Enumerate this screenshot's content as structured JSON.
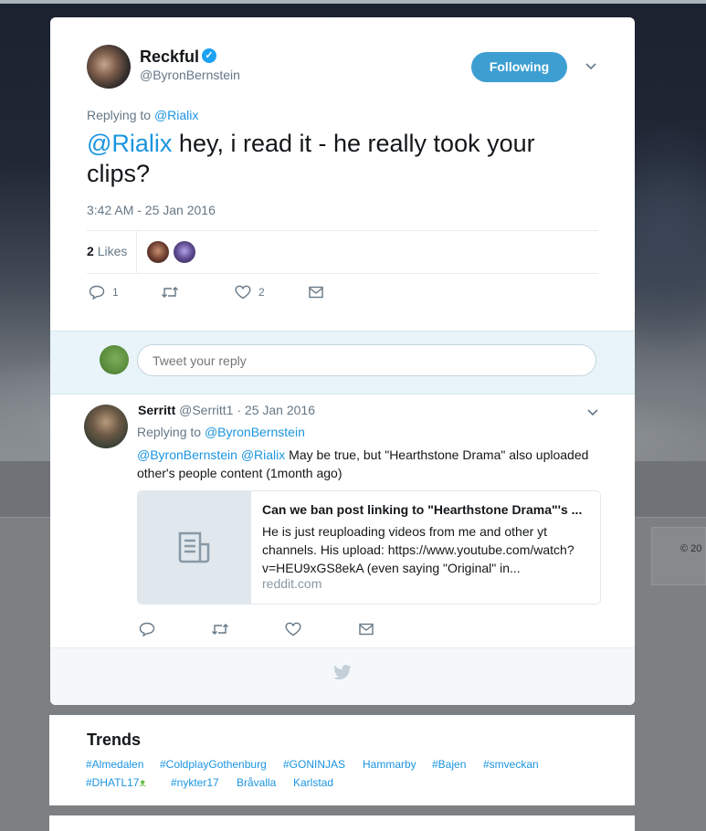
{
  "tweet": {
    "author_name": "Reckful",
    "author_handle": "@ByronBernstein",
    "follow_label": "Following",
    "replying_prefix": "Replying to",
    "replying_to": "@Rialix",
    "text_mention": "@Rialix",
    "text_body": " hey, i read it - he really took your clips?",
    "timestamp": "3:42 AM - 25 Jan 2016",
    "likes_count": "2",
    "likes_label": "Likes",
    "reply_count": "1",
    "like_count": "2"
  },
  "reply_box": {
    "placeholder": "Tweet your reply"
  },
  "reply_tweet": {
    "author_name": "Serritt",
    "author_handle": "@Serritt1",
    "date": "· 25 Jan 2016",
    "replying_prefix": "Replying to",
    "replying_to": "@ByronBernstein",
    "mention_1": "@ByronBernstein",
    "mention_2": "@Rialix",
    "text": "May be true, but \"Hearthstone Drama\" also uploaded other's people content (1month ago)",
    "card": {
      "title": "Can we ban post linking to \"Hearthstone Drama\"'s ...",
      "description": "He is just reuploading videos from me and other yt channels. His upload: https://www.youtube.com/watch?v=HEU9xGS8ekA (even saying \"Original\" in...",
      "domain": "reddit.com"
    }
  },
  "trends": {
    "title": "Trends",
    "items": [
      "#Almedalen",
      "#ColdplayGothenburg",
      "#GONINJAS",
      "Hammarby",
      "#Bajen",
      "#smveckan",
      "#DHATL17",
      "#nykter17",
      "Bråvalla",
      "Karlstad"
    ]
  },
  "side_text": "© 20",
  "colors": {
    "accent": "#1b95e0",
    "follow_button": "#3d9fd1",
    "verified": "#1da1f2"
  }
}
